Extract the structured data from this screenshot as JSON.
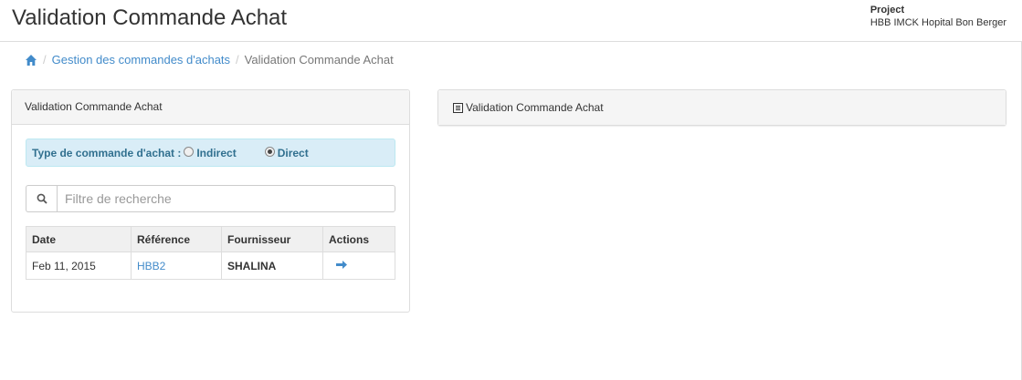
{
  "header": {
    "title": "Validation Commande Achat",
    "project_label": "Project",
    "project_name": "HBB IMCK Hopital Bon Berger"
  },
  "breadcrumb": {
    "home_icon": "home-icon",
    "items": [
      "Gestion des commandes d'achats",
      "Validation Commande Achat"
    ]
  },
  "left_panel": {
    "heading": "Validation Commande Achat",
    "order_type": {
      "label": "Type de commande d'achat :",
      "options": [
        "Indirect",
        "Direct"
      ],
      "selected": "Direct"
    },
    "search": {
      "placeholder": "Filtre de recherche",
      "value": ""
    },
    "table": {
      "columns": [
        "Date",
        "Référence",
        "Fournisseur",
        "Actions"
      ],
      "rows": [
        {
          "date": "Feb 11, 2015",
          "reference": "HBB2",
          "supplier": "SHALINA",
          "action_icon": "arrow-right-icon"
        }
      ]
    }
  },
  "right_panel": {
    "icon": "list-icon",
    "heading": "Validation Commande Achat"
  },
  "colors": {
    "link": "#428bca",
    "alert_bg": "#d9edf7",
    "alert_text": "#31708f"
  }
}
